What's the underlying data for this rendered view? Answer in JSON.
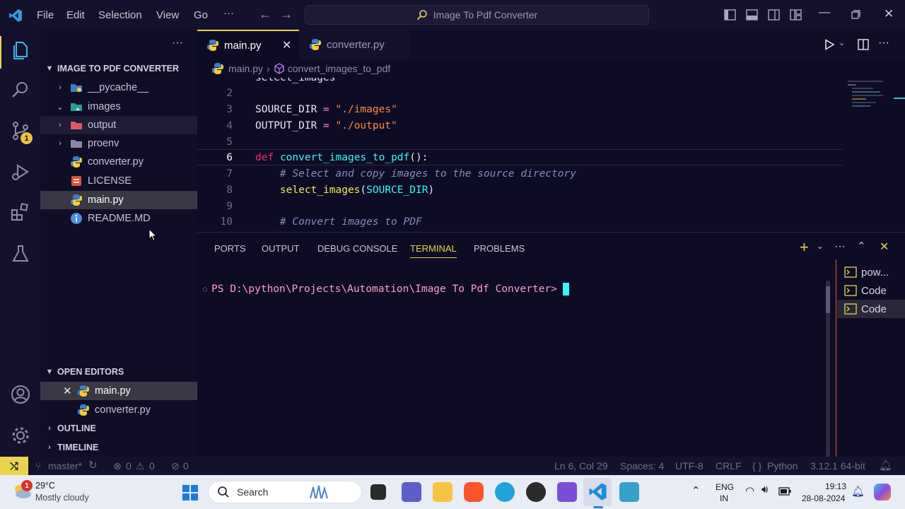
{
  "titlebar": {
    "menus": [
      "File",
      "Edit",
      "Selection",
      "View",
      "Go"
    ],
    "more": "···",
    "command_center": "Image To Pdf Converter"
  },
  "activity": {
    "scm_badge": "1"
  },
  "sidebar": {
    "more": "···",
    "project_title": "IMAGE TO PDF CONVERTER",
    "items": [
      {
        "label": "__pycache__"
      },
      {
        "label": "images"
      },
      {
        "label": "output"
      },
      {
        "label": "proenv"
      },
      {
        "label": "converter.py"
      },
      {
        "label": "LICENSE"
      },
      {
        "label": "main.py"
      },
      {
        "label": "README.MD"
      }
    ],
    "open_editors_title": "OPEN EDITORS",
    "open_editors": [
      {
        "label": "main.py"
      },
      {
        "label": "converter.py"
      }
    ],
    "outline": "OUTLINE",
    "timeline": "TIMELINE"
  },
  "editor": {
    "tabs": [
      {
        "label": "main.py"
      },
      {
        "label": "converter.py"
      }
    ],
    "breadcrumb": {
      "file": "main.py",
      "symbol": "convert_images_to_pdf"
    },
    "lines": [
      {
        "n": "2",
        "text": ""
      },
      {
        "n": "3",
        "text": "SOURCE_DIR = \"./images\""
      },
      {
        "n": "4",
        "text": "OUTPUT_DIR = \"./output\""
      },
      {
        "n": "5",
        "text": ""
      },
      {
        "n": "6",
        "text": "def convert_images_to_pdf():"
      },
      {
        "n": "7",
        "text": "    # Select and copy images to the source directory"
      },
      {
        "n": "8",
        "text": "    select_images(SOURCE_DIR)"
      },
      {
        "n": "9",
        "text": ""
      },
      {
        "n": "10",
        "text": "    # Convert images to PDF"
      }
    ]
  },
  "panel": {
    "tabs": [
      "PORTS",
      "OUTPUT",
      "DEBUG CONSOLE",
      "TERMINAL",
      "PROBLEMS"
    ],
    "active_tab": "TERMINAL",
    "prompt": "PS D:\\python\\Projects\\Automation\\Image To Pdf Converter>",
    "terminals": [
      "pow...",
      "Code",
      "Code"
    ]
  },
  "statusbar": {
    "branch": "master*",
    "errors": "0",
    "warnings": "0",
    "ports": "0",
    "position": "Ln 6, Col 29",
    "spaces": "Spaces: 4",
    "encoding": "UTF-8",
    "eol": "CRLF",
    "language": "Python",
    "interpreter": "3.12.1 64-bit"
  },
  "taskbar": {
    "weather_temp": "29°C",
    "weather_desc": "Mostly cloudy",
    "weather_badge": "1",
    "search": "Search",
    "lang_line1": "ENG",
    "lang_line2": "IN",
    "time": "19:13",
    "date": "28-08-2024"
  },
  "colors": {
    "accent_yellow": "#e8d44d",
    "keyword": "#f92672",
    "function": "#36f9f6",
    "string": "#ff8b39"
  }
}
